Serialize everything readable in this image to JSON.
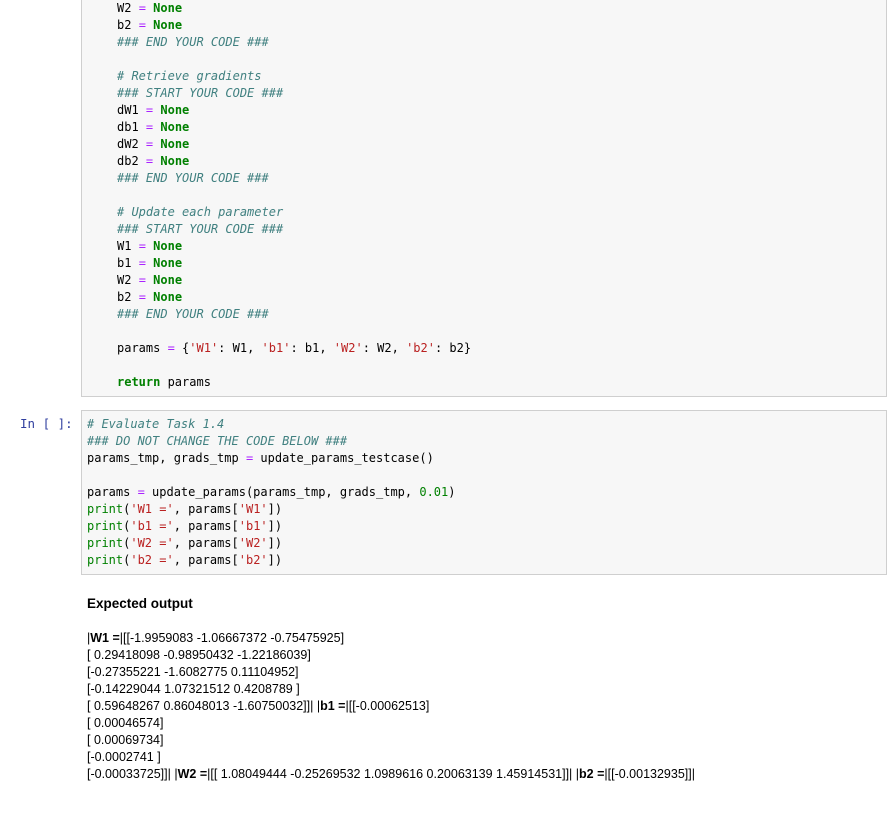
{
  "cell1": {
    "lines": [
      [
        {
          "t": "W2 ",
          "c": ""
        },
        {
          "t": "=",
          "c": "op"
        },
        {
          "t": " ",
          "c": ""
        },
        {
          "t": "None",
          "c": "kw"
        }
      ],
      [
        {
          "t": "b2 ",
          "c": ""
        },
        {
          "t": "=",
          "c": "op"
        },
        {
          "t": " ",
          "c": ""
        },
        {
          "t": "None",
          "c": "kw"
        }
      ],
      [
        {
          "t": "### END YOUR CODE ###",
          "c": "cm"
        }
      ],
      [],
      [
        {
          "t": "# Retrieve gradients",
          "c": "cm"
        }
      ],
      [
        {
          "t": "### START YOUR CODE ###",
          "c": "cm"
        }
      ],
      [
        {
          "t": "dW1 ",
          "c": ""
        },
        {
          "t": "=",
          "c": "op"
        },
        {
          "t": " ",
          "c": ""
        },
        {
          "t": "None",
          "c": "kw"
        }
      ],
      [
        {
          "t": "db1 ",
          "c": ""
        },
        {
          "t": "=",
          "c": "op"
        },
        {
          "t": " ",
          "c": ""
        },
        {
          "t": "None",
          "c": "kw"
        }
      ],
      [
        {
          "t": "dW2 ",
          "c": ""
        },
        {
          "t": "=",
          "c": "op"
        },
        {
          "t": " ",
          "c": ""
        },
        {
          "t": "None",
          "c": "kw"
        }
      ],
      [
        {
          "t": "db2 ",
          "c": ""
        },
        {
          "t": "=",
          "c": "op"
        },
        {
          "t": " ",
          "c": ""
        },
        {
          "t": "None",
          "c": "kw"
        }
      ],
      [
        {
          "t": "### END YOUR CODE ###",
          "c": "cm"
        }
      ],
      [],
      [
        {
          "t": "# Update each parameter",
          "c": "cm"
        }
      ],
      [
        {
          "t": "### START YOUR CODE ###",
          "c": "cm"
        }
      ],
      [
        {
          "t": "W1 ",
          "c": ""
        },
        {
          "t": "=",
          "c": "op"
        },
        {
          "t": " ",
          "c": ""
        },
        {
          "t": "None",
          "c": "kw"
        }
      ],
      [
        {
          "t": "b1 ",
          "c": ""
        },
        {
          "t": "=",
          "c": "op"
        },
        {
          "t": " ",
          "c": ""
        },
        {
          "t": "None",
          "c": "kw"
        }
      ],
      [
        {
          "t": "W2 ",
          "c": ""
        },
        {
          "t": "=",
          "c": "op"
        },
        {
          "t": " ",
          "c": ""
        },
        {
          "t": "None",
          "c": "kw"
        }
      ],
      [
        {
          "t": "b2 ",
          "c": ""
        },
        {
          "t": "=",
          "c": "op"
        },
        {
          "t": " ",
          "c": ""
        },
        {
          "t": "None",
          "c": "kw"
        }
      ],
      [
        {
          "t": "### END YOUR CODE ###",
          "c": "cm"
        }
      ],
      [],
      [
        {
          "t": "params ",
          "c": ""
        },
        {
          "t": "=",
          "c": "op"
        },
        {
          "t": " {",
          "c": ""
        },
        {
          "t": "'W1'",
          "c": "st"
        },
        {
          "t": ": W1, ",
          "c": ""
        },
        {
          "t": "'b1'",
          "c": "st"
        },
        {
          "t": ": b1, ",
          "c": ""
        },
        {
          "t": "'W2'",
          "c": "st"
        },
        {
          "t": ": W2, ",
          "c": ""
        },
        {
          "t": "'b2'",
          "c": "st"
        },
        {
          "t": ": b2}",
          "c": ""
        }
      ],
      [],
      [
        {
          "t": "return",
          "c": "kw"
        },
        {
          "t": " params",
          "c": ""
        }
      ]
    ]
  },
  "cell2": {
    "prompt": "In [ ]:",
    "lines": [
      [
        {
          "t": "# Evaluate Task 1.4",
          "c": "cm"
        }
      ],
      [
        {
          "t": "### DO NOT CHANGE THE CODE BELOW ###",
          "c": "cm"
        }
      ],
      [
        {
          "t": "params_tmp, grads_tmp ",
          "c": ""
        },
        {
          "t": "=",
          "c": "op"
        },
        {
          "t": " update_params_testcase()",
          "c": ""
        }
      ],
      [],
      [
        {
          "t": "params ",
          "c": ""
        },
        {
          "t": "=",
          "c": "op"
        },
        {
          "t": " update_params(params_tmp, grads_tmp, ",
          "c": ""
        },
        {
          "t": "0.01",
          "c": "nm"
        },
        {
          "t": ")",
          "c": ""
        }
      ],
      [
        {
          "t": "print",
          "c": "nm"
        },
        {
          "t": "(",
          "c": ""
        },
        {
          "t": "'W1 ='",
          "c": "st"
        },
        {
          "t": ", params[",
          "c": ""
        },
        {
          "t": "'W1'",
          "c": "st"
        },
        {
          "t": "])",
          "c": ""
        }
      ],
      [
        {
          "t": "print",
          "c": "nm"
        },
        {
          "t": "(",
          "c": ""
        },
        {
          "t": "'b1 ='",
          "c": "st"
        },
        {
          "t": ", params[",
          "c": ""
        },
        {
          "t": "'b1'",
          "c": "st"
        },
        {
          "t": "])",
          "c": ""
        }
      ],
      [
        {
          "t": "print",
          "c": "nm"
        },
        {
          "t": "(",
          "c": ""
        },
        {
          "t": "'W2 ='",
          "c": "st"
        },
        {
          "t": ", params[",
          "c": ""
        },
        {
          "t": "'W2'",
          "c": "st"
        },
        {
          "t": "])",
          "c": ""
        }
      ],
      [
        {
          "t": "print",
          "c": "nm"
        },
        {
          "t": "(",
          "c": ""
        },
        {
          "t": "'b2 ='",
          "c": "st"
        },
        {
          "t": ", params[",
          "c": ""
        },
        {
          "t": "'b2'",
          "c": "st"
        },
        {
          "t": "])",
          "c": ""
        }
      ]
    ]
  },
  "output": {
    "heading": "Expected output",
    "lines": [
      [
        {
          "t": "|",
          "b": false
        },
        {
          "t": "W1 =",
          "b": true
        },
        {
          "t": "|[[-1.9959083 -1.06667372 -0.75475925]",
          "b": false
        }
      ],
      [
        {
          "t": "[ 0.29418098 -0.98950432 -1.22186039]",
          "b": false
        }
      ],
      [
        {
          "t": "[-0.27355221 -1.6082775 0.11104952]",
          "b": false
        }
      ],
      [
        {
          "t": "[-0.14229044 1.07321512 0.4208789 ]",
          "b": false
        }
      ],
      [
        {
          "t": "[ 0.59648267 0.86048013 -1.60750032]]| |",
          "b": false
        },
        {
          "t": "b1 =",
          "b": true
        },
        {
          "t": "|[[-0.00062513]",
          "b": false
        }
      ],
      [
        {
          "t": "[ 0.00046574]",
          "b": false
        }
      ],
      [
        {
          "t": "[ 0.00069734]",
          "b": false
        }
      ],
      [
        {
          "t": "[-0.0002741 ]",
          "b": false
        }
      ],
      [
        {
          "t": "[-0.00033725]]| |",
          "b": false
        },
        {
          "t": "W2 =",
          "b": true
        },
        {
          "t": "|[[ 1.08049444 -0.25269532 1.0989616 0.20063139 1.45914531]]| |",
          "b": false
        },
        {
          "t": "b2 =",
          "b": true
        },
        {
          "t": "|[[-0.00132935]]|",
          "b": false
        }
      ]
    ]
  }
}
